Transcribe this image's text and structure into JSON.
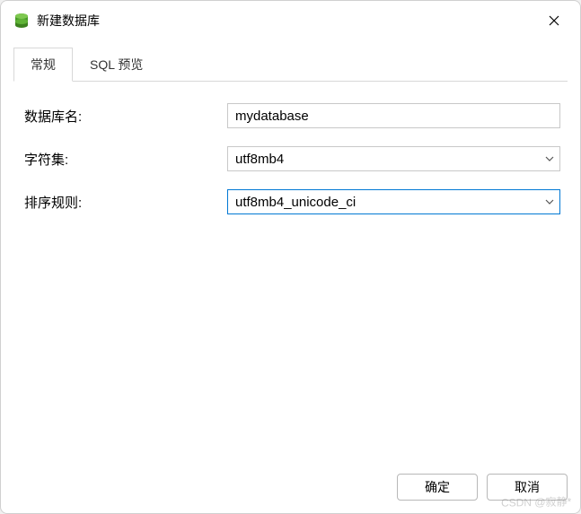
{
  "dialog": {
    "title": "新建数据库"
  },
  "tabs": {
    "general": "常规",
    "sql_preview": "SQL 预览"
  },
  "form": {
    "db_name_label": "数据库名:",
    "db_name_value": "mydatabase",
    "charset_label": "字符集:",
    "charset_value": "utf8mb4",
    "collation_label": "排序规则:",
    "collation_value": "utf8mb4_unicode_ci"
  },
  "buttons": {
    "ok": "确定",
    "cancel": "取消"
  },
  "watermark": "CSDN @寂静*"
}
